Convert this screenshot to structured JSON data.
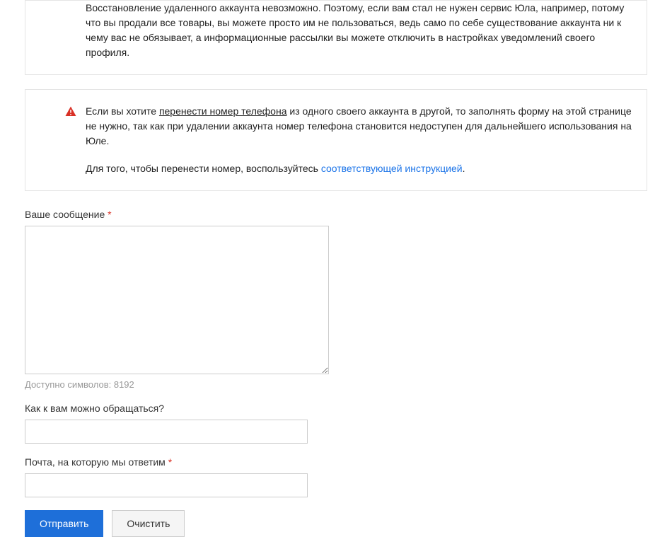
{
  "info": {
    "text": "Восстановление удаленного аккаунта невозможно. Поэтому, если вам стал не нужен сервис Юла, например, потому что вы продали все товары, вы можете просто им не пользоваться, ведь само по себе существование аккаунта ни к чему вас не обязывает, а информационные рассылки вы можете отключить в настройках уведомлений своего профиля."
  },
  "warning": {
    "p1_prefix": "Если вы хотите ",
    "p1_underlined": "перенести номер телефона",
    "p1_suffix": " из одного своего аккаунта в другой, то заполнять форму на этой странице не нужно, так как при удалении аккаунта номер телефона становится недоступен для дальнейшего использования на Юле.",
    "p2_prefix": "Для того, чтобы перенести номер, воспользуйтесь ",
    "p2_link": "соответствующей инструкцией",
    "p2_suffix": "."
  },
  "form": {
    "message_label": "Ваше сообщение",
    "message_value": "",
    "char_counter_prefix": "Доступно символов: ",
    "char_counter_value": "8192",
    "name_label": "Как к вам можно обращаться?",
    "name_value": "",
    "email_label": "Почта, на которую мы ответим",
    "email_value": "",
    "required_mark": "*"
  },
  "buttons": {
    "submit": "Отправить",
    "clear": "Очистить"
  }
}
